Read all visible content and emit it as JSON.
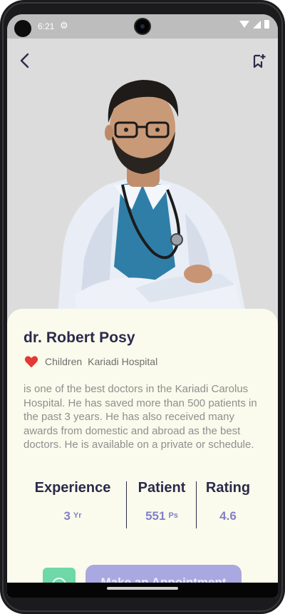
{
  "status_bar": {
    "time": "6:21",
    "settings_icon": "gear-icon",
    "wifi_icon": "wifi-icon",
    "signal_icon": "signal-icon",
    "battery_icon": "battery-icon"
  },
  "header": {
    "back_icon": "chevron-left-icon",
    "bookmark_icon": "bookmark-add-icon"
  },
  "doctor": {
    "name": "dr. Robert Posy",
    "specialty": "Children",
    "hospital": "Kariadi Hospital",
    "favorite_icon": "heart-icon",
    "description": "is one of the best doctors in the Kariadi Carolus Hospital. He has saved more than 500 patients in the past 3 years. He has also received many awards from domestic and abroad as the best doctors. He is available on a private or schedule."
  },
  "stats": {
    "experience": {
      "label": "Experience",
      "value": "3",
      "unit": "Yr"
    },
    "patient": {
      "label": "Patient",
      "value": "551",
      "unit": "Ps"
    },
    "rating": {
      "label": "Rating",
      "value": "4.6"
    }
  },
  "actions": {
    "chat_icon": "chat-icon",
    "appointment_label": "Make an Appointment"
  },
  "colors": {
    "title": "#2b2a4c",
    "accent": "#8280c9",
    "sheet_bg": "#fafbec",
    "heart": "#e53935",
    "chat_green": "#6fd8a8",
    "button_purple": "#a9a8e0"
  }
}
